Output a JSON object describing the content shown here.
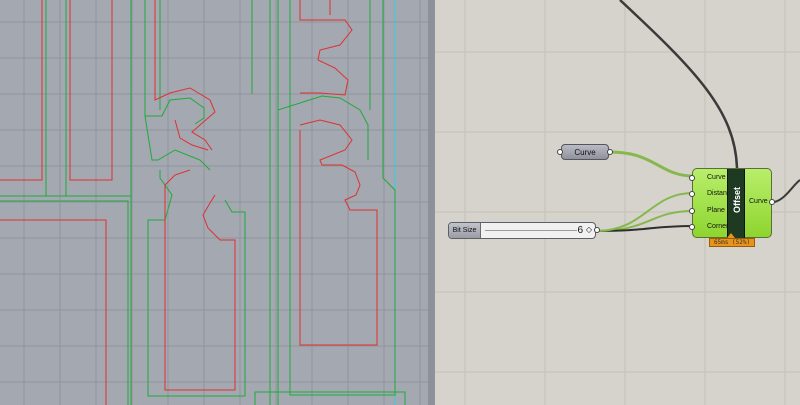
{
  "colors": {
    "viewport_bg": "#a3a8b1",
    "canvas_bg": "#d6d3cc",
    "curve_red": "#e03030",
    "curve_green": "#1faa3a",
    "component_green": "#9ae03e",
    "profiler_orange": "#e8941b",
    "wire_dark": "#3a3a3a",
    "wire_green": "#86b84d"
  },
  "canvas": {
    "curve_param": {
      "label": "Curve"
    },
    "slider": {
      "name": "Bit Size",
      "value": "6",
      "diamond_icon": "diamond-icon"
    },
    "offset_component": {
      "name": "Offset",
      "inputs": [
        "Curve",
        "Distance",
        "Plane",
        "Corners"
      ],
      "output": "Curve",
      "profiler": "65ms (52%)"
    }
  }
}
